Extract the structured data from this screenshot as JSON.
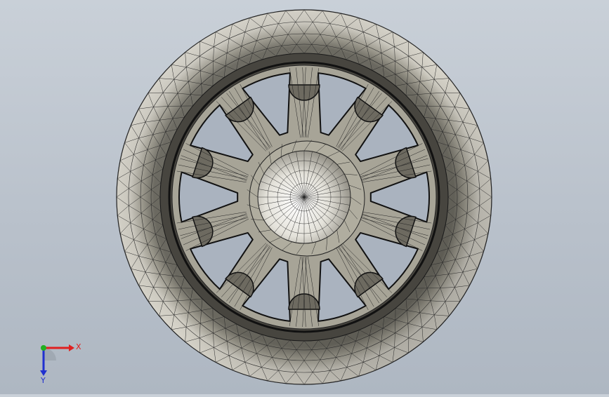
{
  "viewport": {
    "model": "wheel-mesh-front-view",
    "colors": {
      "background_top": "#c9d0d8",
      "background_bottom": "#aeb7c2",
      "rim_light": "#dcdad0",
      "rim_mid": "#b4b1a6",
      "rim_dark": "#5f5d55",
      "spoke": "#a7a497",
      "hub_light": "#ffffff",
      "hub_shadow": "#8e8b81",
      "edge": "#1a1a1a"
    },
    "spoke_count": 10
  },
  "triad": {
    "x_label": "X",
    "y_label": "Y",
    "colors": {
      "x": "#e02020",
      "y": "#20b020",
      "z": "#2030d0"
    }
  }
}
